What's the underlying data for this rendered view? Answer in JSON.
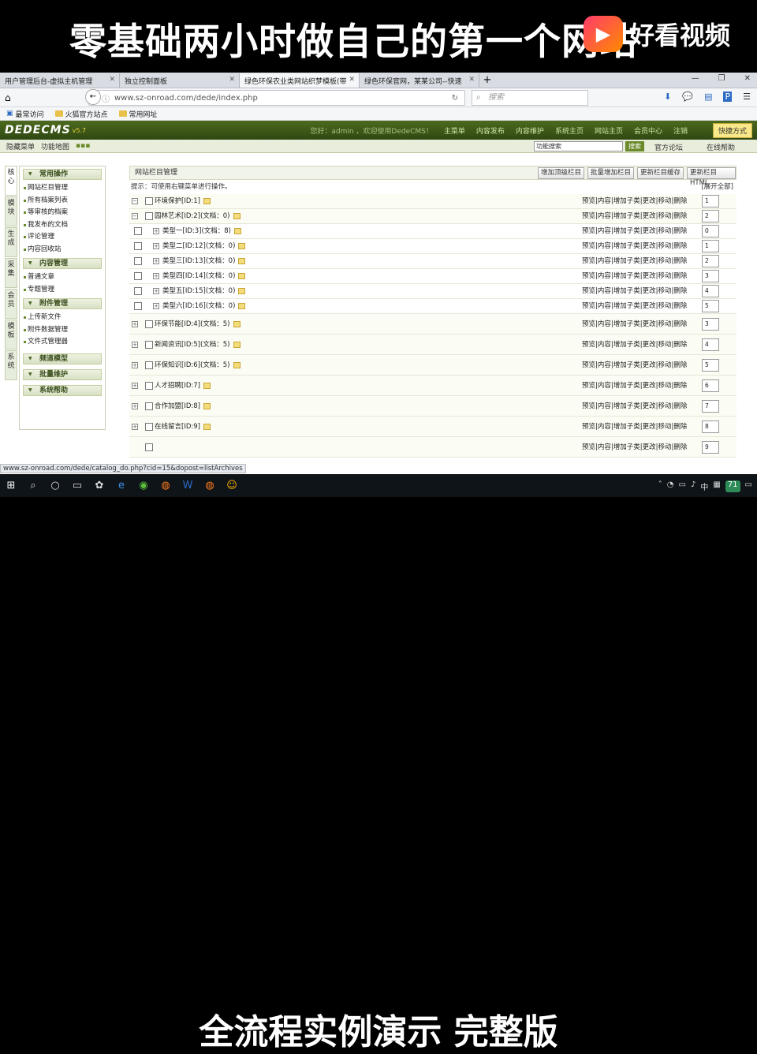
{
  "overlay": {
    "top_title": "零基础两小时做自己的第一个网站",
    "logo_text": "好看视频",
    "logo_icon": "play-icon",
    "bottom_title": "全流程实例演示 完整版"
  },
  "browser": {
    "tabs": [
      {
        "label": "用户管理后台-虚拟主机管理"
      },
      {
        "label": "独立控制面板"
      },
      {
        "label": "绿色环保农业类网站织梦模板(带"
      },
      {
        "label": "绿色环保官网，某某公司--快速"
      }
    ],
    "url": "www.sz-onroad.com/dede/index.php",
    "search_placeholder": "搜索",
    "bookmarks": [
      {
        "label": "最常访问"
      },
      {
        "label": "火狐官方站点"
      },
      {
        "label": "常用网址"
      }
    ],
    "status_url": "www.sz-onroad.com/dede/catalog_do.php?cid=15&dopost=listArchives"
  },
  "cms": {
    "logo": "DEDECMS",
    "version": "v5.7",
    "greeting": "您好：admin ，欢迎使用DedeCMS！",
    "menu": [
      "主菜单",
      "内容发布",
      "内容维护",
      "系统主页",
      "网站主页",
      "会员中心",
      "注销"
    ],
    "quick": "快捷方式",
    "sub": {
      "hide": "隐藏菜单",
      "map": "功能地图",
      "search_value": "功能搜索",
      "search_btn": "搜索",
      "forum": "官方论坛",
      "help": "在线帮助"
    }
  },
  "sidebar": {
    "vtabs": [
      "核心",
      "模块",
      "生成",
      "采集",
      "会员",
      "模板",
      "系统"
    ],
    "groups": [
      {
        "title": "常用操作",
        "items": [
          "网站栏目管理",
          "所有档案列表",
          "等审核的档案",
          "我发布的文档",
          "评论管理",
          "内容回收站"
        ]
      },
      {
        "title": "内容管理",
        "items": [
          "普通文章",
          "专题管理"
        ]
      },
      {
        "title": "附件管理",
        "items": [
          "上传新文件",
          "附件数据管理",
          "文件式管理器"
        ]
      },
      {
        "title": "频道模型",
        "items": []
      },
      {
        "title": "批量维护",
        "items": []
      },
      {
        "title": "系统帮助",
        "items": []
      }
    ]
  },
  "main": {
    "title": "网站栏目管理",
    "buttons": [
      "增加顶级栏目",
      "批量增加栏目",
      "更新栏目缓存",
      "更新栏目HTML"
    ],
    "hint": "提示：可使用右键菜单进行操作。",
    "expand_all": "[展开全部]",
    "ops": "预览|内容|增加子类|更改|移动|删除",
    "rows": [
      {
        "label": "环境保护[ID:1]",
        "order": "1",
        "pm": "−",
        "kind": "top"
      },
      {
        "label": "园林艺术[ID:2](文档：0)",
        "order": "2",
        "pm": "−",
        "kind": "top"
      },
      {
        "label": "类型一[ID:3](文档：8)",
        "order": "0",
        "pm": "+",
        "kind": "child"
      },
      {
        "label": "类型二[ID:12](文档：0)",
        "order": "1",
        "pm": "+",
        "kind": "child"
      },
      {
        "label": "类型三[ID:13](文档：0)",
        "order": "2",
        "pm": "+",
        "kind": "child"
      },
      {
        "label": "类型四[ID:14](文档：0)",
        "order": "3",
        "pm": "+",
        "kind": "child"
      },
      {
        "label": "类型五[ID:15](文档：0)",
        "order": "4",
        "pm": "+",
        "kind": "child"
      },
      {
        "label": "类型六[ID:16](文档：0)",
        "order": "5",
        "pm": "+",
        "kind": "child"
      },
      {
        "label": "环保节能[ID:4](文档：5)",
        "order": "3",
        "pm": "+",
        "kind": "big"
      },
      {
        "label": "新闻资讯[ID:5](文档：5)",
        "order": "4",
        "pm": "+",
        "kind": "big"
      },
      {
        "label": "环保知识[ID:6](文档：5)",
        "order": "5",
        "pm": "+",
        "kind": "big"
      },
      {
        "label": "人才招聘[ID:7]",
        "order": "6",
        "pm": "+",
        "kind": "big"
      },
      {
        "label": "合作加盟[ID:8]",
        "order": "7",
        "pm": "+",
        "kind": "big"
      },
      {
        "label": "在线留言[ID:9]",
        "order": "8",
        "pm": "+",
        "kind": "big"
      },
      {
        "label": "",
        "order": "9",
        "pm": "",
        "kind": "big"
      }
    ]
  },
  "taskbar": {
    "ime": "中",
    "badge": "71"
  }
}
